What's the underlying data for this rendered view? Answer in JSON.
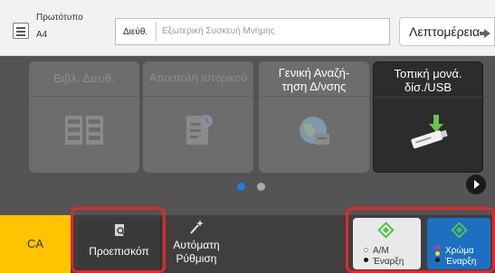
{
  "header": {
    "original_label": "Πρωτότυπο",
    "original_size": "A4",
    "address_label": "Διεύθ.",
    "address_placeholder": "Εξωτερική Συσκευή Μνήμης",
    "details_label": "Λεπτομέρεια"
  },
  "tiles": [
    {
      "label": "Βιβλ. Διευθ.",
      "icon": "address-book-icon",
      "enabled": false
    },
    {
      "label": "Αποστολή Ιστορικού",
      "icon": "send-history-icon",
      "enabled": false
    },
    {
      "label": "Γενική Αναζή-\nτηση Δ/νσης",
      "icon": "global-search-icon",
      "enabled": false
    },
    {
      "label": "Τοπική μονά.\nδίσ./USB",
      "icon": "usb-drive-icon",
      "enabled": true
    }
  ],
  "pagination": {
    "current_page": 1,
    "total_pages": 2
  },
  "bottom": {
    "ca_label": "CA",
    "preview_label": "Προεπισκόπ",
    "auto_label_line1": "Αυτόματη",
    "auto_label_line2": "Ρύθμιση",
    "mono_line1": "A/M",
    "mono_line2": "Έναρξη",
    "color_line1": "Χρώμα",
    "color_line2": "Έναρξη"
  },
  "colors": {
    "ca_button": "#ffc400",
    "highlight_frame": "#e3262b",
    "color_start_button": "#1d6fc2",
    "start_diamond": "#55c24a",
    "page_dot_active": "#1e7fe0"
  }
}
